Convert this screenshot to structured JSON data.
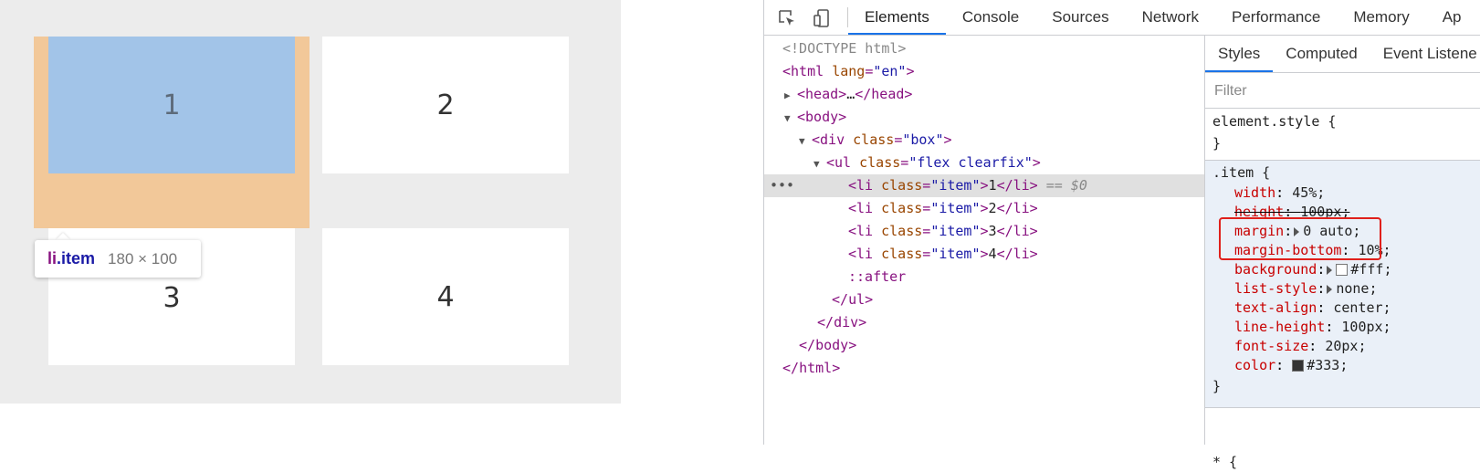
{
  "page": {
    "cards": [
      "1",
      "2",
      "3",
      "4"
    ],
    "tooltip": {
      "tag": "li",
      "class": ".item",
      "size": "180 × 100"
    }
  },
  "devtools": {
    "tabs": [
      "Elements",
      "Console",
      "Sources",
      "Network",
      "Performance",
      "Memory",
      "Ap"
    ],
    "dom": [
      {
        "text": "<!DOCTYPE html>"
      },
      {
        "open": "html",
        "attr": "lang",
        "value": "\"en\""
      },
      {
        "collapsed": "head",
        "ellipsis": "…"
      },
      {
        "open": "body"
      },
      {
        "open": "div",
        "attr": "class",
        "value": "\"box\""
      },
      {
        "open": "ul",
        "attr": "class",
        "value": "\"flex clearfix\""
      },
      {
        "li": "1",
        "selected": true,
        "suffix": "== $0"
      },
      {
        "li": "2"
      },
      {
        "li": "3"
      },
      {
        "li": "4"
      },
      {
        "pseudo": "::after"
      },
      {
        "close": "ul"
      },
      {
        "close": "div"
      },
      {
        "close": "body"
      },
      {
        "close": "html"
      }
    ],
    "styles_tabs": [
      "Styles",
      "Computed",
      "Event Listene"
    ],
    "filter_placeholder": "Filter",
    "element_style_rule": "element.style {",
    "close_brace": "}",
    "item_selector": ".item {",
    "props": [
      {
        "name": "width",
        "value": "45%;"
      },
      {
        "name": "height",
        "value": "100px;"
      },
      {
        "name": "margin",
        "value": "0 auto;",
        "expand": true
      },
      {
        "name": "margin-bottom",
        "value": "10%;"
      },
      {
        "name": "background",
        "value": "#fff;",
        "expand": true,
        "swatch": "#ffffff"
      },
      {
        "name": "list-style",
        "value": "none;",
        "expand": true
      },
      {
        "name": "text-align",
        "value": "center;"
      },
      {
        "name": "line-height",
        "value": "100px;"
      },
      {
        "name": "font-size",
        "value": "20px;"
      },
      {
        "name": "color",
        "value": "#333;",
        "swatch": "#333333"
      }
    ],
    "star_rule": "* {"
  }
}
